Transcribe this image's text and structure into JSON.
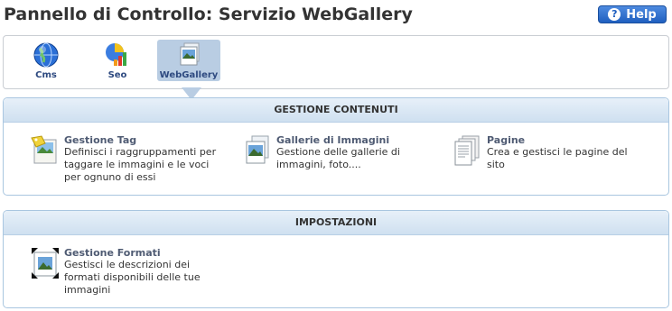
{
  "header": {
    "title": "Pannello di Controllo: Servizio WebGallery",
    "help_label": "Help"
  },
  "tabs": [
    {
      "label": "Cms",
      "icon": "globe-icon"
    },
    {
      "label": "Seo",
      "icon": "seo-chart-icon"
    },
    {
      "label": "WebGallery",
      "icon": "gallery-icon",
      "active": true
    }
  ],
  "sections": [
    {
      "title": "GESTIONE CONTENUTI",
      "items": [
        {
          "title": "Gestione Tag",
          "description": "Definisci i raggruppamenti per taggare le immagini e le voci per ognuno di essi",
          "icon": "tag-icon"
        },
        {
          "title": "Gallerie di Immagini",
          "description": "Gestione delle gallerie di immagini, foto....",
          "icon": "image-gallery-icon"
        },
        {
          "title": "Pagine",
          "description": "Crea e gestisci le pagine del sito",
          "icon": "pages-icon"
        }
      ]
    },
    {
      "title": "IMPOSTAZIONI",
      "items": [
        {
          "title": "Gestione Formati",
          "description": "Gestisci le descrizioni dei formati disponibili delle tue immagini",
          "icon": "resize-image-icon"
        }
      ]
    }
  ]
}
